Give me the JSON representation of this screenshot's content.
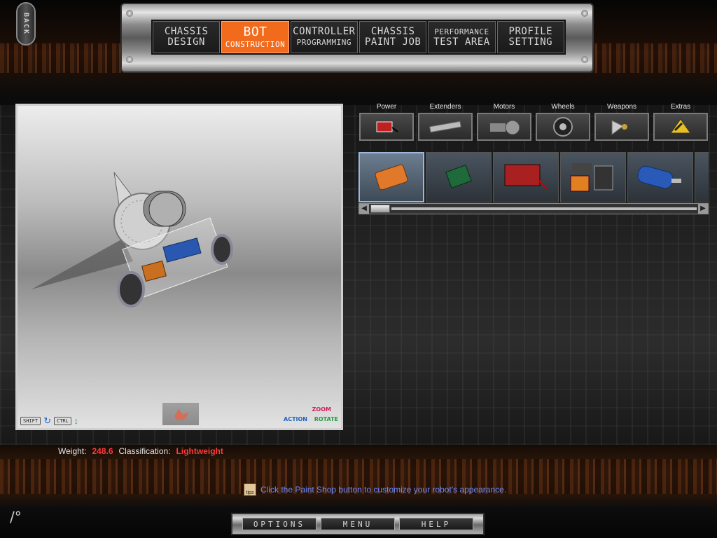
{
  "back": {
    "label": "BACK"
  },
  "nav": {
    "tabs": [
      {
        "line1": "CHASSIS",
        "line2": "DESIGN",
        "active": false
      },
      {
        "line1": "BOT",
        "line2": "CONSTRUCTION",
        "active": true
      },
      {
        "line1": "CONTROLLER",
        "line2": "PROGRAMMING",
        "active": false
      },
      {
        "line1": "CHASSIS",
        "line2": "PAINT JOB",
        "active": false
      },
      {
        "line1": "PERFORMANCE",
        "line2": "TEST AREA",
        "active": false
      },
      {
        "line1": "PROFILE",
        "line2": "SETTING",
        "active": false
      }
    ]
  },
  "viewport": {
    "keys": {
      "shift": "SHIFT",
      "ctrl": "CTRL"
    },
    "legend": {
      "zoom": "ZOOM",
      "action": "ACTION",
      "rotate": "ROTATE"
    }
  },
  "categories": [
    "Power",
    "Extenders",
    "Motors",
    "Wheels",
    "Weapons",
    "Extras"
  ],
  "status": {
    "weight_label": "Weight:",
    "weight_value": "248.6",
    "class_label": "Classification:",
    "class_value": "Lightweight"
  },
  "tip": {
    "icon_text": "tips",
    "text": "Click the Paint Shop button to customize your robot's appearance."
  },
  "bottom_menu": {
    "options": "OPTIONS",
    "menu": "MENU",
    "help": "HELP"
  },
  "colors": {
    "accent": "#f26a1b",
    "alert": "#ff3a3a",
    "tip": "#6d8bff"
  }
}
